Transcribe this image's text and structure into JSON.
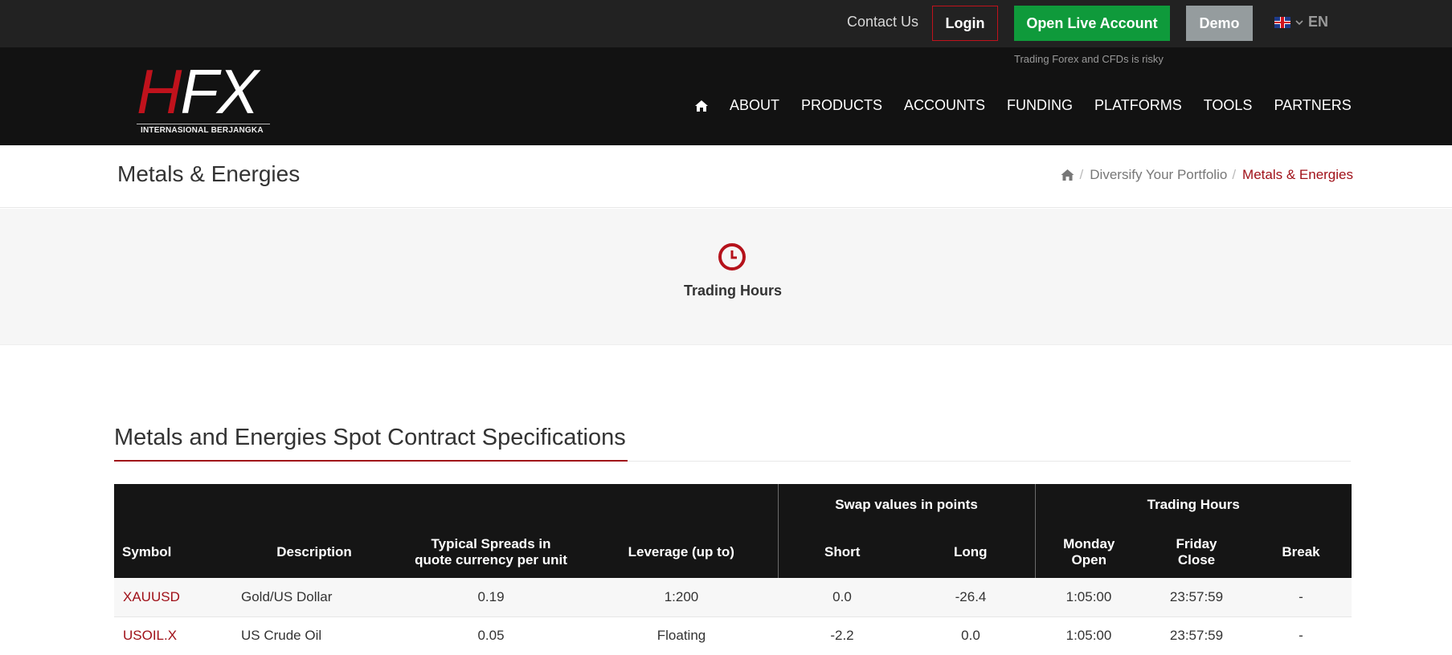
{
  "topbar": {
    "contact": "Contact Us",
    "login": "Login",
    "open_live": "Open Live Account",
    "demo": "Demo",
    "language": "EN"
  },
  "header": {
    "risk_warning": "Trading Forex and CFDs is risky",
    "logo": {
      "main": "HFX",
      "sub": "INTERNASIONAL BERJANGKA"
    },
    "nav": [
      "ABOUT",
      "PRODUCTS",
      "ACCOUNTS",
      "FUNDING",
      "PLATFORMS",
      "TOOLS",
      "PARTNERS"
    ]
  },
  "page": {
    "title": "Metals & Energies",
    "breadcrumb": [
      "Diversify Your Portfolio",
      "Metals & Energies"
    ]
  },
  "trading_hours_link": "Trading Hours",
  "specs": {
    "title": "Metals and Energies Spot Contract Specifications",
    "group_headers": {
      "swap": "Swap values in points",
      "hours": "Trading Hours"
    },
    "columns": {
      "symbol": "Symbol",
      "description": "Description",
      "spreads_1": "Typical Spreads in",
      "spreads_2": "quote currency per unit",
      "leverage": "Leverage (up to)",
      "short": "Short",
      "long": "Long",
      "monday_1": "Monday",
      "monday_2": "Open",
      "friday_1": "Friday",
      "friday_2": "Close",
      "break": "Break"
    },
    "rows": [
      {
        "symbol": "XAUUSD",
        "description": "Gold/US Dollar",
        "spread": "0.19",
        "leverage": "1:200",
        "short": "0.0",
        "long": "-26.4",
        "monday": "1:05:00",
        "friday": "23:57:59",
        "break": "-"
      },
      {
        "symbol": "USOIL.X",
        "description": "US Crude Oil",
        "spread": "0.05",
        "leverage": "Floating",
        "short": "-2.2",
        "long": "0.0",
        "monday": "1:05:00",
        "friday": "23:57:59",
        "break": "-"
      }
    ]
  },
  "colors": {
    "brand_red": "#a01119",
    "green": "#0f9a3b",
    "dark": "#121212"
  }
}
